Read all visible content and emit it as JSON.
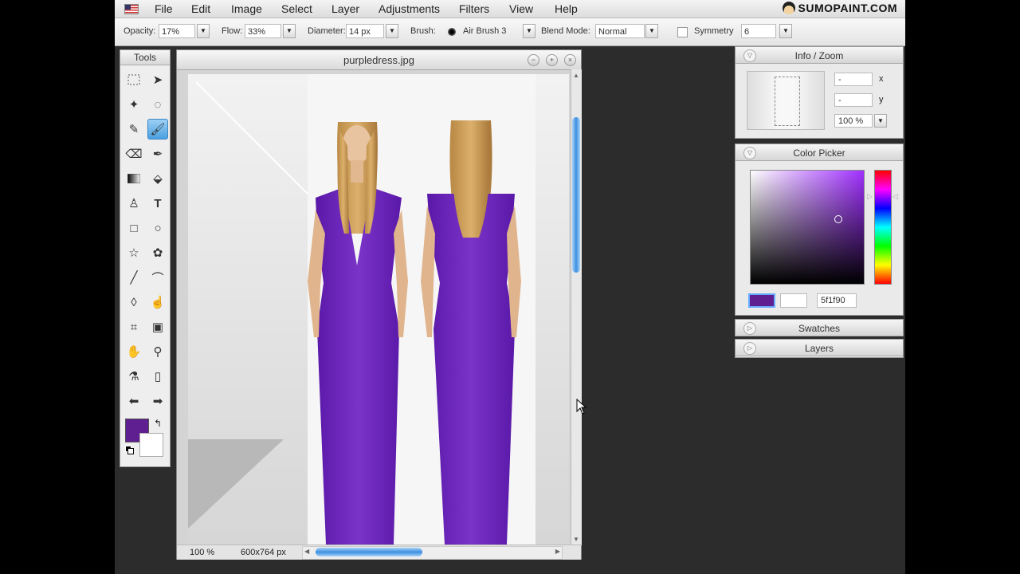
{
  "menu": [
    "File",
    "Edit",
    "Image",
    "Select",
    "Layer",
    "Adjustments",
    "Filters",
    "View",
    "Help"
  ],
  "brand": "SUMOPAINT.COM",
  "options": {
    "opacity_label": "Opacity:",
    "opacity_value": "17%",
    "flow_label": "Flow:",
    "flow_value": "33%",
    "diameter_label": "Diameter:",
    "diameter_value": "14 px",
    "brush_label": "Brush:",
    "brush_value": "Air Brush 3",
    "blend_label": "Blend Mode:",
    "blend_value": "Normal",
    "symmetry_label": "Symmetry",
    "symmetry_value": "6"
  },
  "tools_title": "Tools",
  "document": {
    "title": "purpledress.jpg",
    "zoom": "100 %",
    "size": "600x764 px"
  },
  "info_zoom": {
    "title": "Info / Zoom",
    "x_value": "-",
    "x_label": "x",
    "y_value": "-",
    "y_label": "y",
    "zoom_value": "100 %"
  },
  "color_picker": {
    "title": "Color Picker",
    "hex": "5f1f90",
    "foreground_color": "#5f1f90",
    "background_color": "#ffffff"
  },
  "swatches_title": "Swatches",
  "layers_title": "Layers"
}
